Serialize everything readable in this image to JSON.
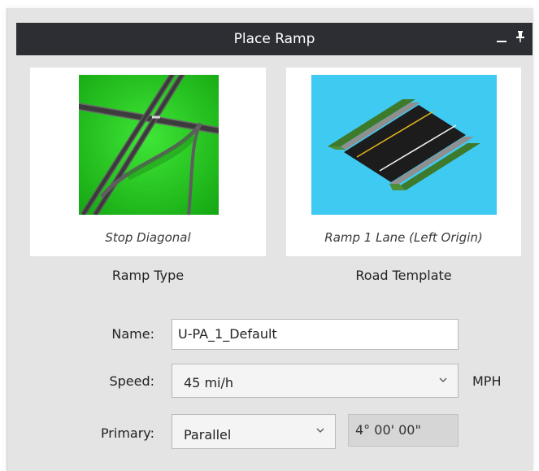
{
  "window": {
    "title": "Place Ramp",
    "minimize_icon": "minimize-icon",
    "pin_icon": "pin-icon"
  },
  "ramp_type": {
    "caption": "Stop Diagonal",
    "label": "Ramp Type",
    "thumbnail_icon": "interchange-thumbnail"
  },
  "road_template": {
    "caption": "Ramp 1 Lane (Left Origin)",
    "label": "Road Template",
    "thumbnail_icon": "road-segment-thumbnail"
  },
  "form": {
    "name_label": "Name:",
    "name_value": "U-PA_1_Default",
    "speed_label": "Speed:",
    "speed_value": "45 mi/h",
    "speed_unit": "MPH",
    "primary_label": "Primary:",
    "primary_value": "Parallel",
    "angle_value": "4° 00' 00\""
  },
  "colors": {
    "titlebar": "#2c2e33",
    "panel": "#e4e4e4",
    "grass": "#22c41c",
    "sky": "#3fcaf2"
  }
}
